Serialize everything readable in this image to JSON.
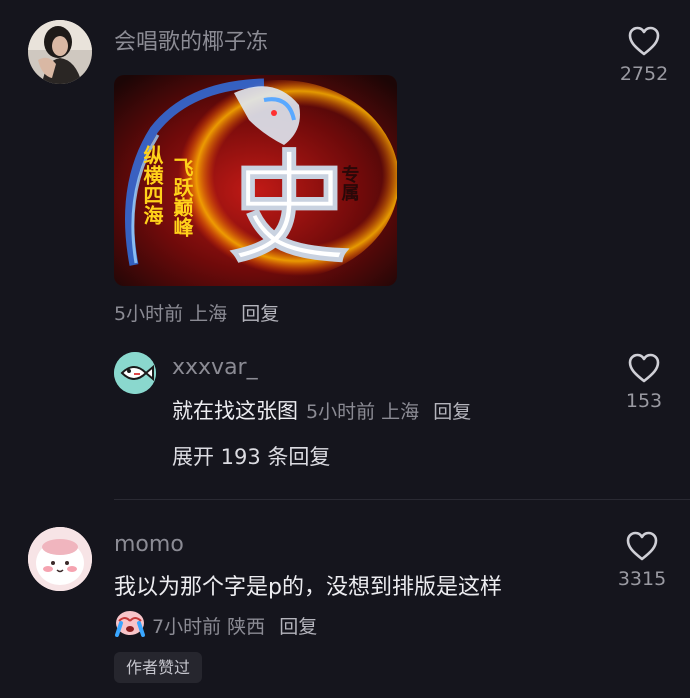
{
  "comments": [
    {
      "username": "会唱歌的椰子冻",
      "image": {
        "overlay_char": "史",
        "left_verse": "纵横四海",
        "right_verse": "飞跃巅峰",
        "badge_text": "专属"
      },
      "time": "5小时前",
      "location": "上海",
      "reply_label": "回复",
      "likes": "2752"
    },
    {
      "username": "xxxvar_",
      "text": "就在找这张图",
      "time": "5小时前",
      "location": "上海",
      "reply_label": "回复",
      "likes": "153"
    },
    {
      "username": "momo",
      "text": "我以为那个字是p的，没想到排版是这样",
      "time": "7小时前",
      "location": "陕西",
      "reply_label": "回复",
      "likes": "3315",
      "badge": "作者赞过"
    }
  ],
  "expand_replies": "展开 193 条回复",
  "icons": {
    "like": "heart-outline-icon",
    "emoji": "crying-face-icon"
  },
  "colors": {
    "background": "#15151d",
    "muted_text": "#8b8b94",
    "primary_text": "#ececf0"
  }
}
